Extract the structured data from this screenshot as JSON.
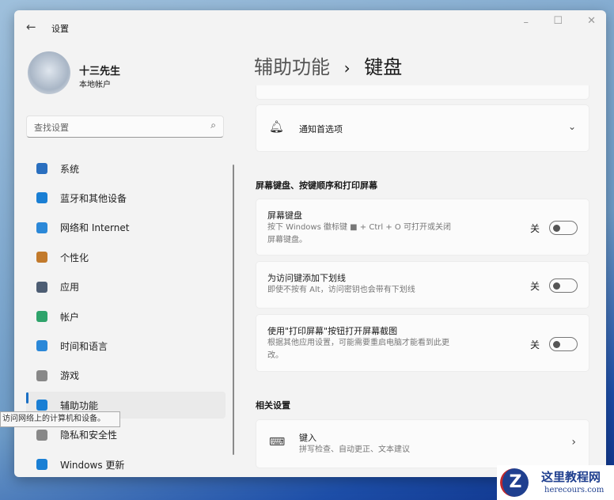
{
  "window": {
    "title": "设置"
  },
  "user": {
    "name": "十三先生",
    "account": "本地帐户"
  },
  "search": {
    "placeholder": "查找设置"
  },
  "sidebar": {
    "items": [
      {
        "label": "系统",
        "color": "#2a6fbf"
      },
      {
        "label": "蓝牙和其他设备",
        "color": "#1a7fd4"
      },
      {
        "label": "网络和 Internet",
        "color": "#2b88d8"
      },
      {
        "label": "个性化",
        "color": "#c27a2c"
      },
      {
        "label": "应用",
        "color": "#4d5d73"
      },
      {
        "label": "帐户",
        "color": "#2fa36b"
      },
      {
        "label": "时间和语言",
        "color": "#2b88d8"
      },
      {
        "label": "游戏",
        "color": "#888888"
      },
      {
        "label": "辅助功能",
        "color": "#1a7fd4"
      },
      {
        "label": "隐私和安全性",
        "color": "#888888"
      },
      {
        "label": "Windows 更新",
        "color": "#1a7fd4"
      }
    ]
  },
  "tooltip": "访问网络上的计算机和设备。",
  "breadcrumb": {
    "parent": "辅助功能",
    "sep": "›",
    "current": "键盘"
  },
  "notify": {
    "label": "通知首选项"
  },
  "section1": "屏幕键盘、按键顺序和打印屏幕",
  "settings": [
    {
      "title": "屏幕键盘",
      "desc": "按下 Windows 徽标键 ■ + Ctrl + O 可打开或关闭屏幕键盘。",
      "state": "关"
    },
    {
      "title": "为访问键添加下划线",
      "desc": "即使不按有 Alt，访问密钥也会带有下划线",
      "state": "关"
    },
    {
      "title": "使用\"打印屏幕\"按钮打开屏幕截图",
      "desc": "根据其他应用设置，可能需要重启电脑才能看到此更改。",
      "state": "关"
    }
  ],
  "section2": "相关设置",
  "typing": {
    "title": "键入",
    "desc": "拼写检查、自动更正、文本建议"
  },
  "watermark": {
    "name": "这里教程网",
    "url": "herecours.com"
  }
}
